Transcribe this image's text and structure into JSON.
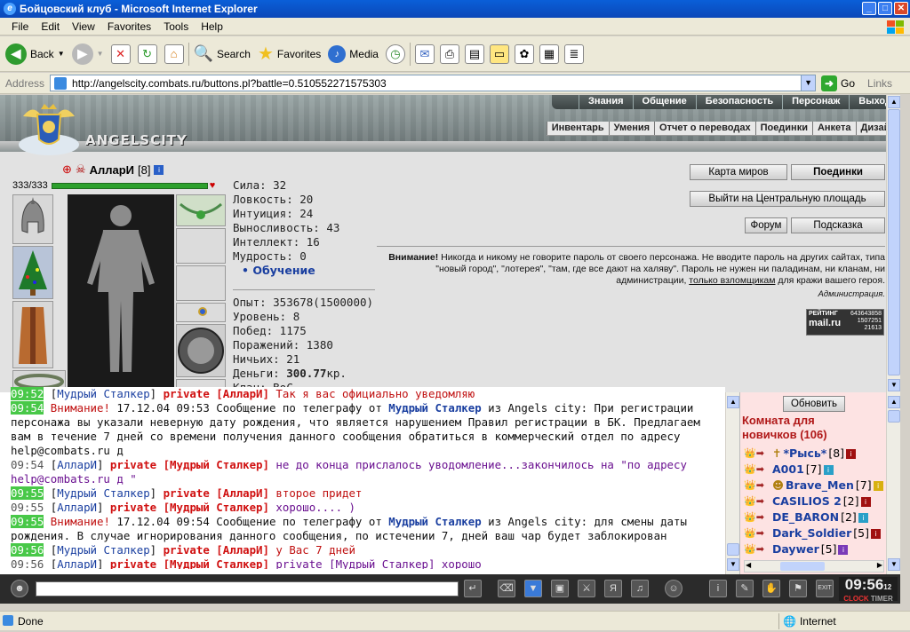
{
  "window": {
    "title": "Бойцовский клуб - Microsoft Internet Explorer"
  },
  "menu": [
    "File",
    "Edit",
    "View",
    "Favorites",
    "Tools",
    "Help"
  ],
  "toolbar": {
    "back": "Back",
    "search": "Search",
    "favorites": "Favorites",
    "media": "Media"
  },
  "address": {
    "label": "Address",
    "url": "http://angelscity.combats.ru/buttons.pl?battle=0.510552271575303",
    "go": "Go",
    "links": "Links"
  },
  "game": {
    "brand": "ANGELSCITY",
    "nav_top": [
      "Знания",
      "Общение",
      "Безопасность",
      "Персонаж",
      "Выход"
    ],
    "nav_sub": [
      "Инвентарь",
      "Умения",
      "Отчет о переводах",
      "Поединки",
      "Анкета",
      "Дизайн"
    ],
    "character": {
      "name": "АлларИ",
      "level": "[8]",
      "hp": "333/333"
    },
    "stats": {
      "s1": "Сила: 32",
      "s2": "Ловкость: 20",
      "s3": "Интуиция: 24",
      "s4": "Выносливость: 43",
      "s5": "Интеллект: 16",
      "s6": "Мудрость: 0",
      "learn": "Обучение",
      "exp": "Опыт: 353678(1500000)",
      "lvl": "Уровень: 8",
      "wins": "Побед: 1175",
      "loss": "Поражений: 1380",
      "draw": "Ничьих: 21",
      "money_label": "Деньги:",
      "money_value": "300.77",
      "money_unit": "кр.",
      "clan": "Клан: BoC"
    },
    "buttons": {
      "map": "Карта миров",
      "fights": "Поединки",
      "exit_square": "Выйти на Центральную площадь",
      "forum": "Форум",
      "hint": "Подсказка"
    },
    "warning": {
      "bold": "Внимание!",
      "p1": " Никогда и никому не говорите пароль от своего персонажа. Не вводите пароль на других сайтах, типа \"новый город\", \"лотерея\", \"там, где все дают на халяву\". Пароль не нужен ни паладинам, ни кланам, ни администрации, ",
      "link": "только взломщикам",
      "p2": " для кражи вашего героя.",
      "adm": "Администрация."
    },
    "rating": {
      "label": "РЕЙТИНГ",
      "brand": "mail.ru",
      "n1": "643643858",
      "n2": "1507251",
      "n3": "21613"
    }
  },
  "chat": [
    {
      "time": "09:52",
      "tcls": "tg",
      "parts": [
        {
          "c": "black",
          "t": " ["
        },
        {
          "c": "nm",
          "t": "Мудрый Сталкер"
        },
        {
          "c": "black",
          "t": "] "
        },
        {
          "c": "pr",
          "t": "private [АлларИ]"
        },
        {
          "c": "al",
          "t": " Так я вас официально уведомляю"
        }
      ]
    },
    {
      "time": "09:54",
      "tcls": "tg",
      "parts": [
        {
          "c": "al",
          "t": " Внимание!"
        },
        {
          "c": "black",
          "t": " 17.12.04 09:53 Сообщение по телеграфу от "
        },
        {
          "c": "gb",
          "t": "Мудрый Сталкер"
        },
        {
          "c": "black",
          "t": " из Angels city: При регистрации персонажа вы указали неверную дату рождения, что является нарушением Правил регистрации в БК. Предлагаем вам в течение 7 дней со времени получения данного сообщения обратиться в коммерческий отдел по адресу help@combats.ru д"
        }
      ]
    },
    {
      "time": "09:54",
      "tcls": "tw",
      "parts": [
        {
          "c": "black",
          "t": " ["
        },
        {
          "c": "nm",
          "t": "АлларИ"
        },
        {
          "c": "black",
          "t": "] "
        },
        {
          "c": "pr",
          "t": "private [Мудрый Сталкер]"
        },
        {
          "c": "tx",
          "t": " не до конца прислалось уводомление...закончилось на \"по адресу help@combats.ru д \""
        }
      ]
    },
    {
      "time": "09:55",
      "tcls": "tg",
      "parts": [
        {
          "c": "black",
          "t": " ["
        },
        {
          "c": "nm",
          "t": "Мудрый Сталкер"
        },
        {
          "c": "black",
          "t": "] "
        },
        {
          "c": "pr",
          "t": "private [АлларИ]"
        },
        {
          "c": "al",
          "t": " второе придет"
        }
      ]
    },
    {
      "time": "09:55",
      "tcls": "tw",
      "parts": [
        {
          "c": "black",
          "t": " ["
        },
        {
          "c": "nm",
          "t": "АлларИ"
        },
        {
          "c": "black",
          "t": "] "
        },
        {
          "c": "pr",
          "t": "private [Мудрый Сталкер]"
        },
        {
          "c": "tx",
          "t": " хорошо.... )"
        }
      ]
    },
    {
      "time": "09:55",
      "tcls": "tg",
      "parts": [
        {
          "c": "al",
          "t": " Внимание!"
        },
        {
          "c": "black",
          "t": " 17.12.04 09:54 Сообщение по телеграфу от "
        },
        {
          "c": "gb",
          "t": "Мудрый Сталкер"
        },
        {
          "c": "black",
          "t": " из Angels city: для смены даты рождения. В случае игнорирования данного сообщения, по истечении 7, дней ваш чар будет заблокирован"
        }
      ]
    },
    {
      "time": "09:56",
      "tcls": "tg",
      "parts": [
        {
          "c": "black",
          "t": " ["
        },
        {
          "c": "nm",
          "t": "Мудрый Сталкер"
        },
        {
          "c": "black",
          "t": "] "
        },
        {
          "c": "pr",
          "t": "private [АлларИ]"
        },
        {
          "c": "al",
          "t": " у Вас 7 дней"
        }
      ]
    },
    {
      "time": "09:56",
      "tcls": "tw",
      "parts": [
        {
          "c": "black",
          "t": " ["
        },
        {
          "c": "nm",
          "t": "АлларИ"
        },
        {
          "c": "black",
          "t": "] "
        },
        {
          "c": "pr",
          "t": "private [Мудрый Сталкер]"
        },
        {
          "c": "tx",
          "t": " private [Мудрый Сталкер] хорошо"
        }
      ]
    }
  ],
  "side": {
    "refresh": "Обновить",
    "room_line1": "Комната для",
    "room_line2": "новичков (106)",
    "users": [
      {
        "name": "*Рысь*",
        "lvl": "[8]",
        "badge": "#a01010",
        "pre": "✝"
      },
      {
        "name": "A001",
        "lvl": "[7]",
        "badge": "#2aa0c8",
        "pre": ""
      },
      {
        "name": "Brave_Men",
        "lvl": "[7]",
        "badge": "#d8b010",
        "pre": "☻"
      },
      {
        "name": "CASILIOS 2",
        "lvl": "[2]",
        "badge": "#a01010",
        "pre": ""
      },
      {
        "name": "DE_BARON",
        "lvl": "[2]",
        "badge": "#2aa0c8",
        "pre": ""
      },
      {
        "name": "Dark_Soldier",
        "lvl": "[5]",
        "badge": "#a01010",
        "pre": ""
      },
      {
        "name": "Daywer",
        "lvl": "[5]",
        "badge": "#7a3ab8",
        "pre": ""
      }
    ]
  },
  "clock": {
    "time": "09:56",
    "sec": "12",
    "clock_lbl": "CLOCK",
    "timer_lbl": "TIMER"
  },
  "status": {
    "text": "Done",
    "zone": "Internet"
  }
}
